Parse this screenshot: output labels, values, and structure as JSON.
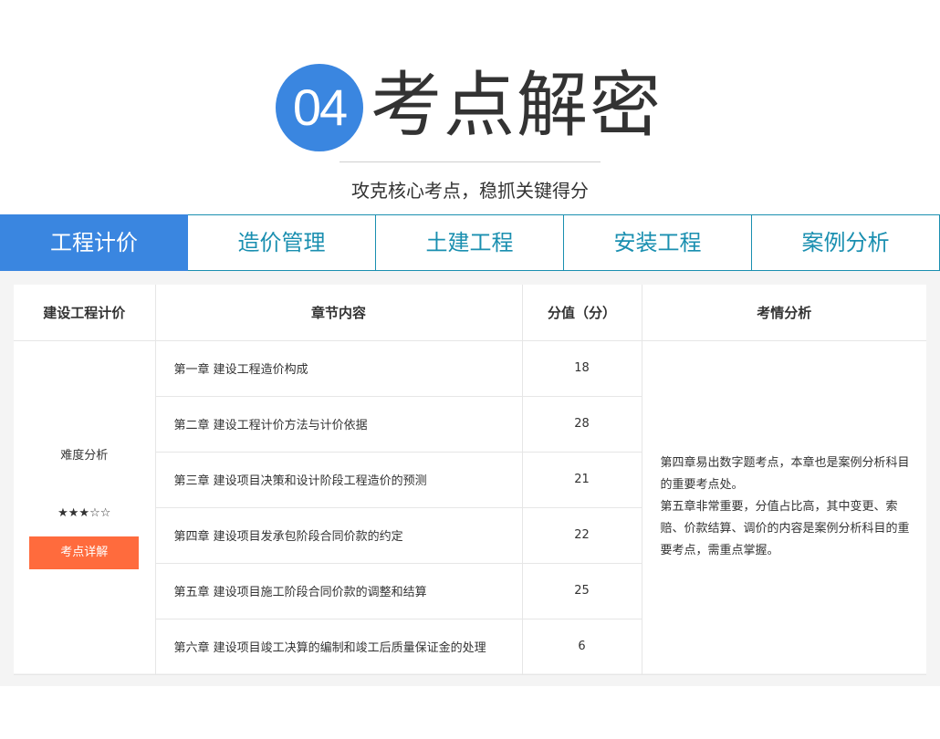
{
  "header": {
    "badge": "04",
    "title": "考点解密",
    "subtitle": "攻克核心考点，稳抓关键得分"
  },
  "tabs": [
    {
      "label": "工程计价",
      "active": true
    },
    {
      "label": "造价管理",
      "active": false
    },
    {
      "label": "土建工程",
      "active": false
    },
    {
      "label": "安装工程",
      "active": false
    },
    {
      "label": "案例分析",
      "active": false
    }
  ],
  "table": {
    "headers": [
      "建设工程计价",
      "章节内容",
      "分值（分）",
      "考情分析"
    ],
    "rows": [
      {
        "chapter": "第一章  建设工程造价构成",
        "score": "18"
      },
      {
        "chapter": "第二章  建设工程计价方法与计价依据",
        "score": "28"
      },
      {
        "chapter": "第三章  建设项目决策和设计阶段工程造价的预测",
        "score": "21"
      },
      {
        "chapter": "第四章  建设项目发承包阶段合同价款的约定",
        "score": "22"
      },
      {
        "chapter": "第五章  建设项目施工阶段合同价款的调整和结算",
        "score": "25"
      },
      {
        "chapter": "第六章  建设项目竣工决算的编制和竣工后质量保证金的处理",
        "score": "6"
      }
    ],
    "difficulty_label": "难度分析",
    "stars": "★★★☆☆",
    "stars_value": 3,
    "stars_max": 5,
    "detail_button": "考点详解",
    "analysis": [
      "第四章易出数字题考点，本章也是案例分析科目的重要考点处。",
      "第五章非常重要，分值占比高，其中变更、索赔、价款结算、调价的内容是案例分析科目的重要考点，需重点掌握。"
    ]
  },
  "colors": {
    "accent_blue": "#3a86e0",
    "tab_text": "#1a8fb0",
    "button_orange": "#ff6b3d"
  }
}
